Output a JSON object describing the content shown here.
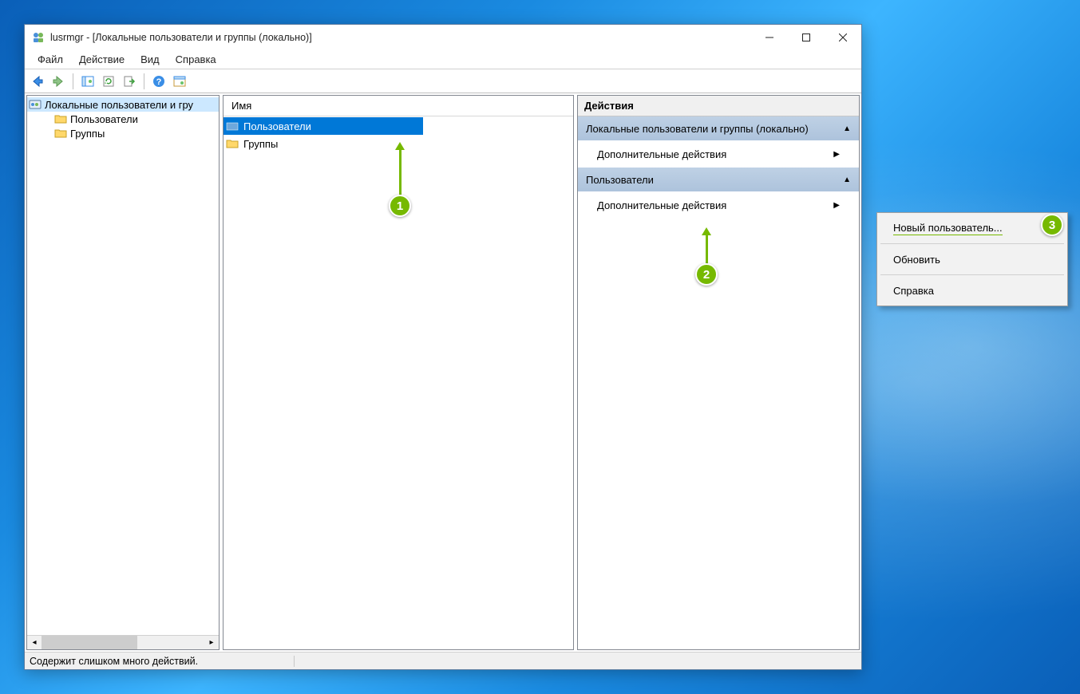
{
  "window": {
    "title": "lusrmgr - [Локальные пользователи и группы (локально)]"
  },
  "menubar": {
    "file": "Файл",
    "action": "Действие",
    "view": "Вид",
    "help": "Справка"
  },
  "tree": {
    "root": "Локальные пользователи и гру",
    "users": "Пользователи",
    "groups": "Группы"
  },
  "list": {
    "col_name": "Имя",
    "users_row": "Пользователи",
    "groups_row": "Группы"
  },
  "actions": {
    "header": "Действия",
    "section1": "Локальные пользователи и группы (локально)",
    "more_actions1": "Дополнительные действия",
    "section2": "Пользователи",
    "more_actions2": "Дополнительные действия"
  },
  "context_menu": {
    "new_user": "Новый пользователь...",
    "refresh": "Обновить",
    "help": "Справка"
  },
  "statusbar": {
    "text": "Содержит слишком много действий."
  },
  "markers": {
    "m1": "1",
    "m2": "2",
    "m3": "3"
  },
  "toolbar_icons": {
    "back": "back-icon",
    "forward": "forward-icon",
    "show_hide": "pane-icon",
    "refresh": "refresh-icon",
    "export": "export-icon",
    "help": "help-icon",
    "properties": "properties-icon"
  }
}
